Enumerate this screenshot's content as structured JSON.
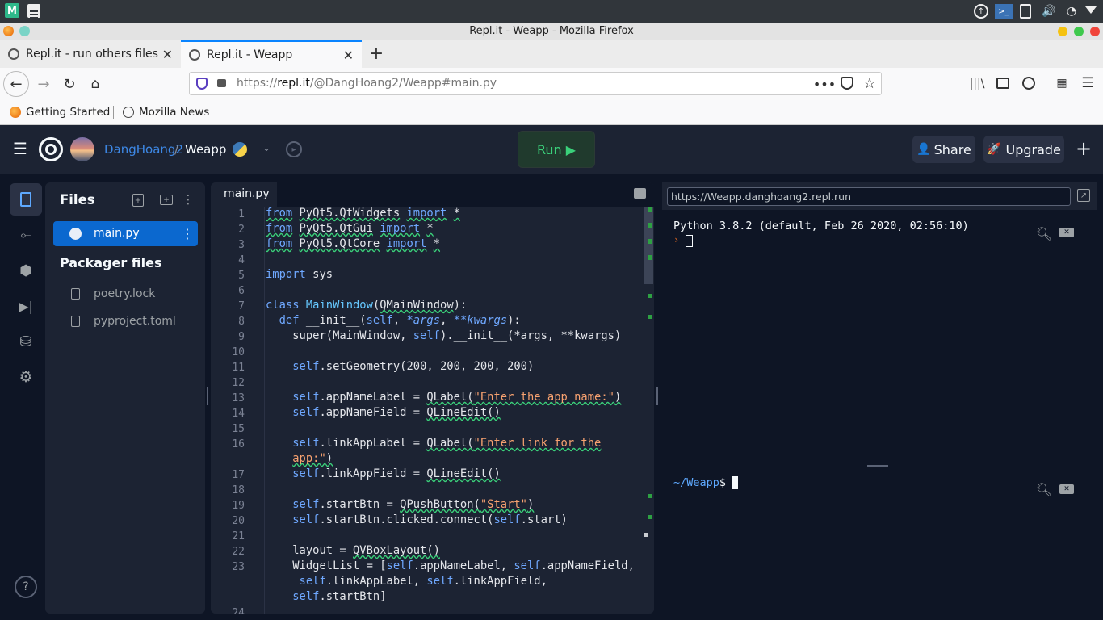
{
  "browser": {
    "window_title": "Repl.it - Weapp - Mozilla Firefox",
    "tabs": [
      {
        "label": "Repl.it - run others files"
      },
      {
        "label": "Repl.it - Weapp"
      }
    ],
    "url_prefix": "https://",
    "url_domain": "repl.it",
    "url_path": "/@DangHoang2/Weapp#main.py",
    "bookmarks": [
      {
        "label": "Getting Started"
      },
      {
        "label": "Mozilla News"
      }
    ]
  },
  "header": {
    "user": "DangHoang2",
    "separator": "/",
    "repl": "Weapp",
    "run_label": "Run ▶",
    "share_label": "Share",
    "upgrade_label": "Upgrade"
  },
  "files": {
    "title": "Files",
    "items": [
      {
        "label": "main.py"
      }
    ],
    "packager_title": "Packager files",
    "packager_items": [
      {
        "label": "poetry.lock"
      },
      {
        "label": "pyproject.toml"
      }
    ]
  },
  "editor": {
    "tab": "main.py",
    "line_numbers": [
      "1",
      "2",
      "3",
      "4",
      "5",
      "6",
      "7",
      "8",
      "9",
      "10",
      "11",
      "12",
      "13",
      "14",
      "15",
      "16",
      "",
      "17",
      "18",
      "19",
      "20",
      "21",
      "22",
      "23",
      "",
      "",
      "24"
    ]
  },
  "console": {
    "url": "https://Weapp.danghoang2.repl.run",
    "python_version": "Python 3.8.2 (default, Feb 26 2020, 02:56:10)",
    "prompt": "~/Weapp",
    "dollar": "$"
  },
  "colors": {
    "accent": "#0079f2",
    "run_green": "#3ad07a",
    "user_link": "#3d88e6"
  }
}
